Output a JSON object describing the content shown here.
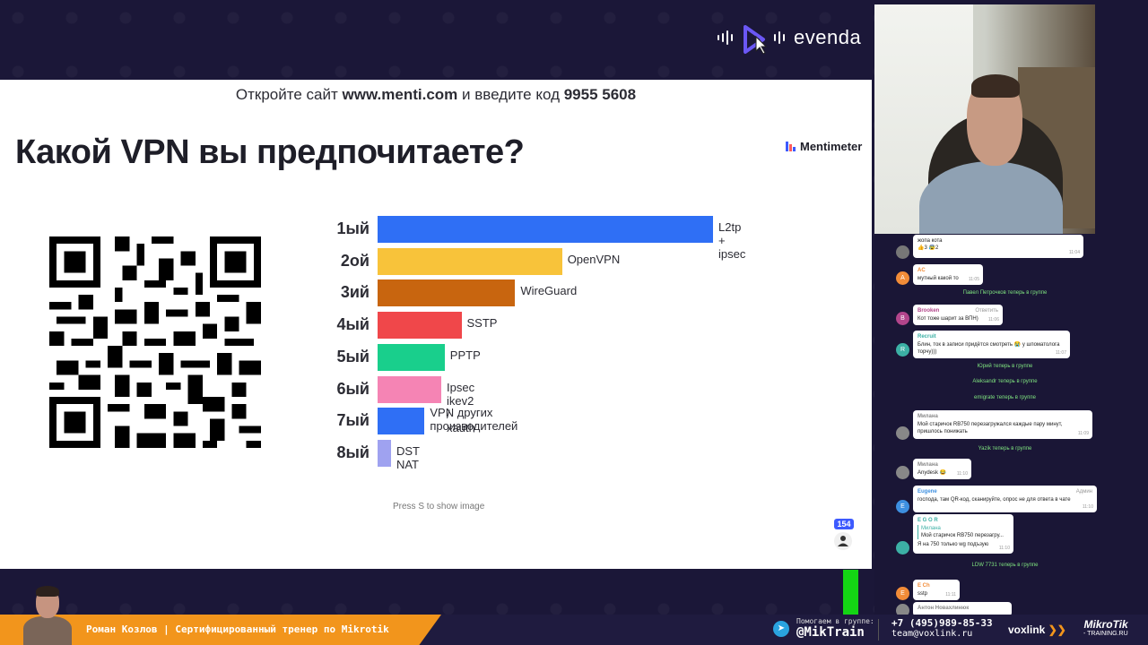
{
  "brand": {
    "name": "evenda"
  },
  "slide": {
    "url_prefix": "Откройте сайт ",
    "url": "www.menti.com",
    "url_mid": " и введите код ",
    "code": "9955 5608",
    "title": "Какой VPN вы предпочитаете?",
    "menti_brand": "Mentimeter",
    "press_hint": "Press S to show image",
    "responses": "154"
  },
  "chart_data": {
    "type": "bar",
    "orientation": "horizontal",
    "categories": [
      "1ый",
      "2ой",
      "3ий",
      "4ый",
      "5ый",
      "6ый",
      "7ый",
      "8ый"
    ],
    "labels": [
      "L2tp + ipsec",
      "OpenVPN",
      "WireGuard",
      "SSTP",
      "PPTP",
      "Ipsec ikev2 / xauth",
      "VPN других\nпроизводителей",
      "DST NAT"
    ],
    "values": [
      100,
      55,
      41,
      25,
      20,
      19,
      14,
      4
    ],
    "colors": [
      "#2f6ff5",
      "#f8c33a",
      "#c8650f",
      "#f0474a",
      "#19cf8c",
      "#f584b4",
      "#2f6ff5",
      "#9fa2f0"
    ]
  },
  "chat": {
    "messages": [
      {
        "name": "",
        "text": "жопа кота",
        "reactions": "👍3  😰2",
        "time": "11:04",
        "avatar": "",
        "color": "#777"
      },
      {
        "name": "AC",
        "text": "мутный какой то",
        "time": "11:05",
        "avatar": "A",
        "color": "#f28c38"
      },
      {
        "system": "Павел Петрочков теперь в группе"
      },
      {
        "name": "Brooken",
        "text": "Кот тоже шарит за ВПН)",
        "time": "11:06",
        "avatar": "B",
        "color": "#b2458b",
        "action": "Ответить"
      },
      {
        "name": "Recruit",
        "text": "Блин, ток в записи придётся смотреть 😭 у шпоматолога торчу)))",
        "time": "11:07",
        "avatar": "R",
        "color": "#3cb0a5"
      },
      {
        "system": "Юрий теперь в группе"
      },
      {
        "system": "Aleksandr теперь в группе"
      },
      {
        "system": "emigrate теперь в группе"
      },
      {
        "name": "Милана",
        "text": "Мой старичок RB750 перезагружался каждые пару минут, пришлось понижать",
        "time": "11:09",
        "avatar": "",
        "color": "#888"
      },
      {
        "system": "Yazik теперь в группе"
      },
      {
        "name": "Милана",
        "text": "Anydesk 😂",
        "time": "11:10",
        "avatar": "",
        "color": "#888"
      },
      {
        "name": "Eugene",
        "text": "господа, там QR-код, сканируйте, опрос не для ответа в чате",
        "time": "11:10",
        "avatar": "E",
        "color": "#3d8fe0",
        "action": "Админ"
      },
      {
        "name": "Е G O R",
        "quote_name": "Милана",
        "quote": "Мой старичок RB750 перезагру...",
        "text": "Я на 750 только wg подъзую",
        "time": "11:10",
        "avatar": "",
        "color": "#3cb0a5"
      },
      {
        "system": "LDW 7731 теперь в группе"
      },
      {
        "name": "E Ch",
        "text": "sstp",
        "time": "11:11",
        "avatar": "E",
        "color": "#f28c38"
      },
      {
        "name": "Антон Новахлинюк",
        "text": "",
        "time": "",
        "avatar": "",
        "color": "#888"
      }
    ]
  },
  "footer": {
    "presenter": "Роман Козлов | Сертифицированный тренер по Mikrotik",
    "group_prefix": "Помогаем в группе:",
    "group": "@MikTrain",
    "phone": "+7 (495)989-85-33",
    "email": "team@voxlink.ru",
    "voxlink": "voxlink",
    "mikrotik": "MikroTik",
    "mikrotik_sub": "- TRAINING.RU"
  }
}
